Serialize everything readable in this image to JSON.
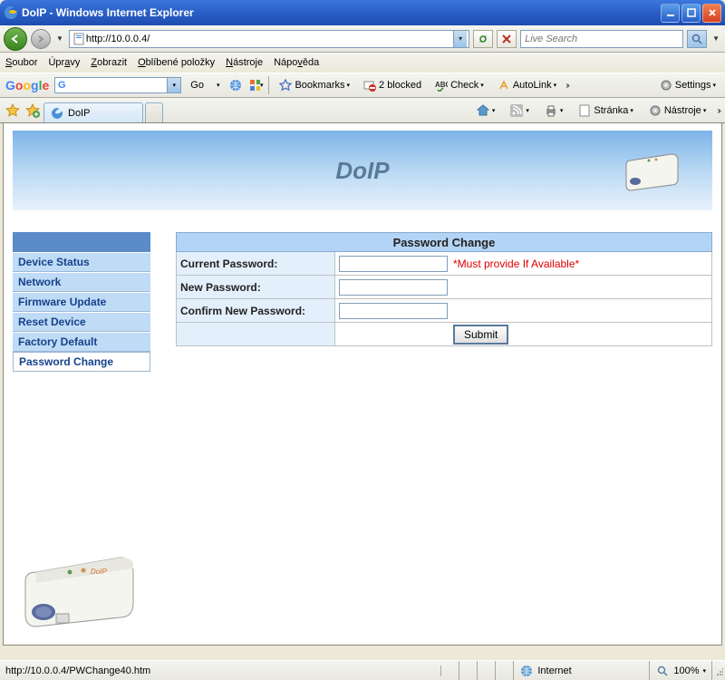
{
  "window": {
    "title": "DoIP - Windows Internet Explorer"
  },
  "address": {
    "url": "http://10.0.0.4/"
  },
  "search": {
    "placeholder": "Live Search"
  },
  "menu": {
    "soubor": "Soubor",
    "upravy": "Úpravy",
    "zobrazit": "Zobrazit",
    "oblibene": "Oblíbené položky",
    "nastroje": "Nástroje",
    "napoveda": "Nápověda"
  },
  "googlebar": {
    "go": "Go",
    "bookmarks": "Bookmarks",
    "blocked": "2 blocked",
    "check": "Check",
    "autolink": "AutoLink",
    "settings": "Settings"
  },
  "tab": {
    "title": "DoIP"
  },
  "tabbar_right": {
    "stranka": "Stránka",
    "nastroje": "Nástroje"
  },
  "banner": {
    "title": "DoIP"
  },
  "sidebar": {
    "items": [
      "Device Status",
      "Network",
      "Firmware Update",
      "Reset Device",
      "Factory Default",
      "Password Change"
    ]
  },
  "panel": {
    "title": "Password Change",
    "current_pw": "Current Password:",
    "new_pw": "New Password:",
    "confirm_pw": "Confirm New Password:",
    "note": "*Must provide If Available*",
    "submit": "Submit"
  },
  "status": {
    "url": "http://10.0.0.4/PWChange40.htm",
    "zone": "Internet",
    "zoom": "100%"
  }
}
